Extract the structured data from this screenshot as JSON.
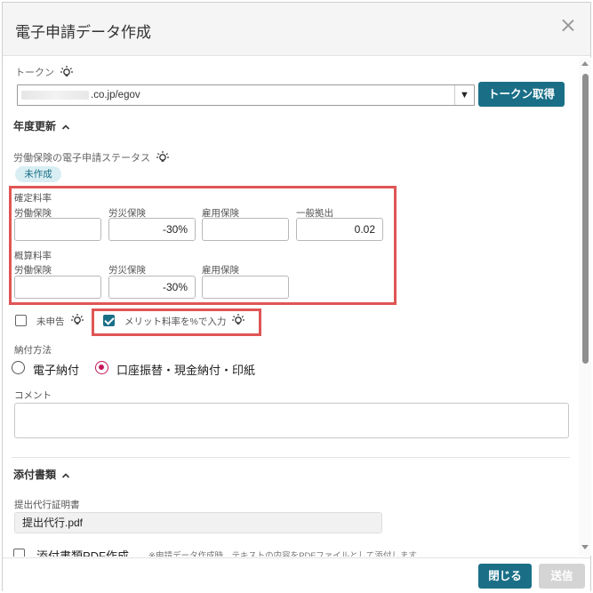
{
  "dialog": {
    "title": "電子申請データ作成"
  },
  "token": {
    "label": "トークン",
    "value": ".co.jp/egov",
    "caret": "▼",
    "fetch_button": "トークン取得"
  },
  "year_update": {
    "header": "年度更新",
    "chevron": "^",
    "status_label": "労働保険の電子申請ステータス",
    "status_badge": "未作成",
    "confirmed_rate": {
      "header": "確定料率",
      "labels": [
        "労働保険",
        "労災保険",
        "雇用保険",
        "一般拠出"
      ],
      "values": [
        "",
        "-30%",
        "",
        "0.02"
      ]
    },
    "estimated_rate": {
      "header": "概算料率",
      "labels": [
        "労働保険",
        "労災保険",
        "雇用保険"
      ],
      "values": [
        "",
        "-30%",
        ""
      ]
    },
    "not_filed_label": "未申告",
    "not_filed_checked": false,
    "merit_label": "メリット料率を%で入力",
    "merit_checked": true,
    "payment_method_label": "納付方法",
    "payment_options": [
      "電子納付",
      "口座振替・現金納付・印紙"
    ],
    "payment_selected": "口座振替・現金納付・印紙",
    "comment_label": "コメント",
    "comment_value": ""
  },
  "attachments": {
    "header": "添付書類",
    "chevron": "^",
    "proxy_cert_label": "提出代行証明書",
    "proxy_cert_file": "提出代行.pdf",
    "pdf_create_label": "添付書類PDF作成",
    "pdf_create_note": "※申請データ作成時、テキストの内容をPDFファイルとして添付します"
  },
  "footer": {
    "close_button": "閉じる",
    "send_button": "送信"
  },
  "colors": {
    "primary": "#1a6f87",
    "highlight_border": "#e05555",
    "radio_selected": "#c2185b",
    "disabled": "#d4d4d4"
  },
  "icons": [
    "close-icon",
    "lightbulb-icon",
    "chevron-up-icon",
    "dropdown-caret-icon",
    "checkbox-icon",
    "radio-icon",
    "scroll-up-icon",
    "scroll-down-icon"
  ]
}
